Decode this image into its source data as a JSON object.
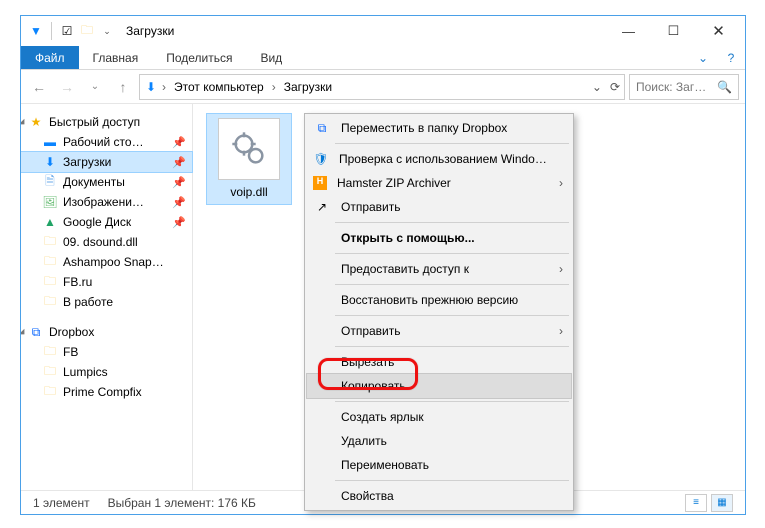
{
  "titlebar": {
    "title": "Загрузки"
  },
  "ribbon": {
    "file": "Файл",
    "tabs": [
      "Главная",
      "Поделиться",
      "Вид"
    ]
  },
  "address": {
    "crumbs": [
      "Этот компьютер",
      "Загрузки"
    ],
    "search_placeholder": "Поиск: Заг…"
  },
  "sidebar": {
    "quick": {
      "header": "Быстрый доступ",
      "items": [
        {
          "icon": "desktop",
          "label": "Рабочий сто…",
          "pinned": true
        },
        {
          "icon": "dl",
          "label": "Загрузки",
          "pinned": true,
          "selected": true
        },
        {
          "icon": "doc",
          "label": "Документы",
          "pinned": true
        },
        {
          "icon": "img",
          "label": "Изображени…",
          "pinned": true
        },
        {
          "icon": "gdrive",
          "label": "Google Диск",
          "pinned": true
        },
        {
          "icon": "folder",
          "label": "09. dsound.dll",
          "pinned": false
        },
        {
          "icon": "folder",
          "label": "Ashampoo Snap…",
          "pinned": false
        },
        {
          "icon": "folder",
          "label": "FB.ru",
          "pinned": false
        },
        {
          "icon": "folder",
          "label": "В работе",
          "pinned": false
        }
      ]
    },
    "dropbox": {
      "header": "Dropbox",
      "items": [
        {
          "label": "FB"
        },
        {
          "label": "Lumpics"
        },
        {
          "label": "Prime Compfix"
        }
      ]
    }
  },
  "file": {
    "name": "voip.dll"
  },
  "statusbar": {
    "count": "1 элемент",
    "selection": "Выбран 1 элемент: 176 КБ"
  },
  "context_menu": {
    "items": [
      {
        "icon": "dropbox",
        "label": "Переместить в папку Dropbox",
        "type": "item"
      },
      {
        "type": "sep"
      },
      {
        "icon": "shield",
        "label": "Проверка с использованием Windows Defender...",
        "type": "item"
      },
      {
        "icon": "hzip",
        "label": "Hamster ZIP Archiver",
        "type": "submenu"
      },
      {
        "icon": "share",
        "label": "Отправить",
        "type": "item"
      },
      {
        "type": "sep"
      },
      {
        "label": "Открыть с помощью...",
        "type": "item",
        "bold": true
      },
      {
        "type": "sep"
      },
      {
        "label": "Предоставить доступ к",
        "type": "submenu"
      },
      {
        "type": "sep"
      },
      {
        "label": "Восстановить прежнюю версию",
        "type": "item"
      },
      {
        "type": "sep"
      },
      {
        "label": "Отправить",
        "type": "submenu"
      },
      {
        "type": "sep"
      },
      {
        "label": "Вырезать",
        "type": "item"
      },
      {
        "label": "Копировать",
        "type": "item",
        "highlighted": true
      },
      {
        "type": "sep"
      },
      {
        "label": "Создать ярлык",
        "type": "item"
      },
      {
        "label": "Удалить",
        "type": "item"
      },
      {
        "label": "Переименовать",
        "type": "item"
      },
      {
        "type": "sep"
      },
      {
        "label": "Свойства",
        "type": "item"
      }
    ]
  }
}
